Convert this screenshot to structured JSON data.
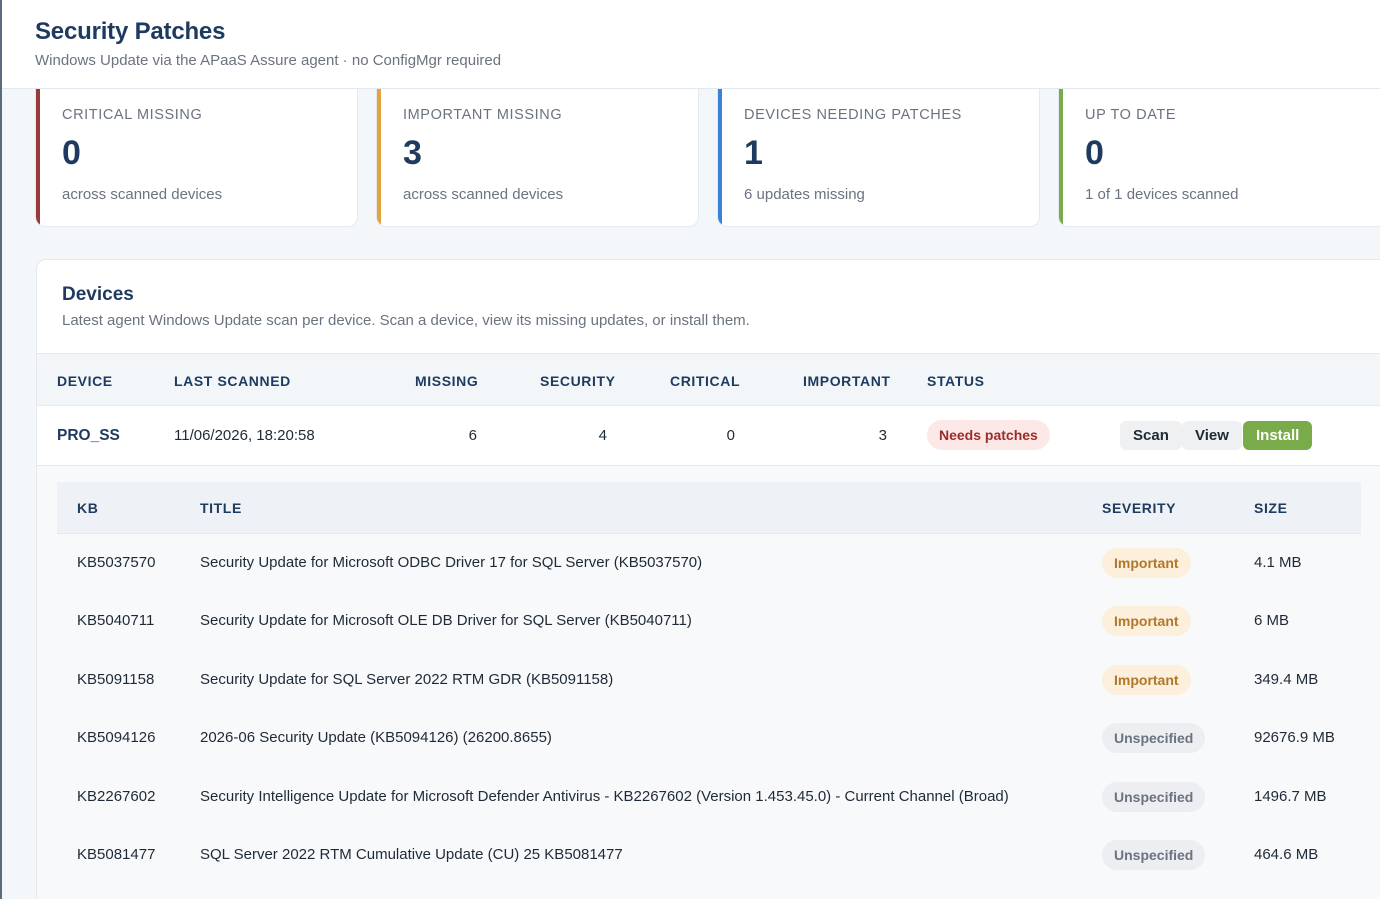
{
  "header": {
    "title": "Security Patches",
    "subtitle": "Windows Update via the APaaS Assure agent · no ConfigMgr required"
  },
  "cards": [
    {
      "label": "CRITICAL MISSING",
      "value": "0",
      "sub": "across scanned devices",
      "accent": "#9b3a3a"
    },
    {
      "label": "IMPORTANT MISSING",
      "value": "3",
      "sub": "across scanned devices",
      "accent": "#e2a33c"
    },
    {
      "label": "DEVICES NEEDING PATCHES",
      "value": "1",
      "sub": "6 updates missing",
      "accent": "#3b82d6"
    },
    {
      "label": "UP TO DATE",
      "value": "0",
      "sub": "1 of 1 devices scanned",
      "accent": "#7aab4a"
    }
  ],
  "devices": {
    "title": "Devices",
    "description": "Latest agent Windows Update scan per device. Scan a device, view its missing updates, or install them.",
    "columns": [
      "DEVICE",
      "LAST SCANNED",
      "MISSING",
      "SECURITY",
      "CRITICAL",
      "IMPORTANT",
      "STATUS"
    ],
    "rows": [
      {
        "device": "PRO_SS",
        "last_scanned": "11/06/2026, 18:20:58",
        "missing": "6",
        "security": "4",
        "critical": "0",
        "important": "3",
        "status": "Needs patches",
        "actions": {
          "scan": "Scan",
          "view": "View",
          "install": "Install"
        }
      }
    ]
  },
  "updates": {
    "columns": [
      "KB",
      "TITLE",
      "SEVERITY",
      "SIZE"
    ],
    "rows": [
      {
        "kb": "KB5037570",
        "title": "Security Update for Microsoft ODBC Driver 17 for SQL Server (KB5037570)",
        "severity": "Important",
        "size": "4.1 MB"
      },
      {
        "kb": "KB5040711",
        "title": "Security Update for Microsoft OLE DB Driver for SQL Server (KB5040711)",
        "severity": "Important",
        "size": "6 MB"
      },
      {
        "kb": "KB5091158",
        "title": "Security Update for SQL Server 2022 RTM GDR (KB5091158)",
        "severity": "Important",
        "size": "349.4 MB"
      },
      {
        "kb": "KB5094126",
        "title": "2026-06 Security Update (KB5094126) (26200.8655)",
        "severity": "Unspecified",
        "size": "92676.9 MB"
      },
      {
        "kb": "KB2267602",
        "title": "Security Intelligence Update for Microsoft Defender Antivirus - KB2267602 (Version 1.453.45.0) - Current Channel (Broad)",
        "severity": "Unspecified",
        "size": "1496.7 MB"
      },
      {
        "kb": "KB5081477",
        "title": "SQL Server 2022 RTM Cumulative Update (CU) 25 KB5081477",
        "severity": "Unspecified",
        "size": "464.6 MB"
      }
    ]
  },
  "colors": {
    "primary": "#1e3a5f",
    "install": "#7aab4a",
    "needs_patches_bg": "#fde8e8",
    "important_bg": "#fcefdc",
    "unspecified_bg": "#eceef1"
  }
}
